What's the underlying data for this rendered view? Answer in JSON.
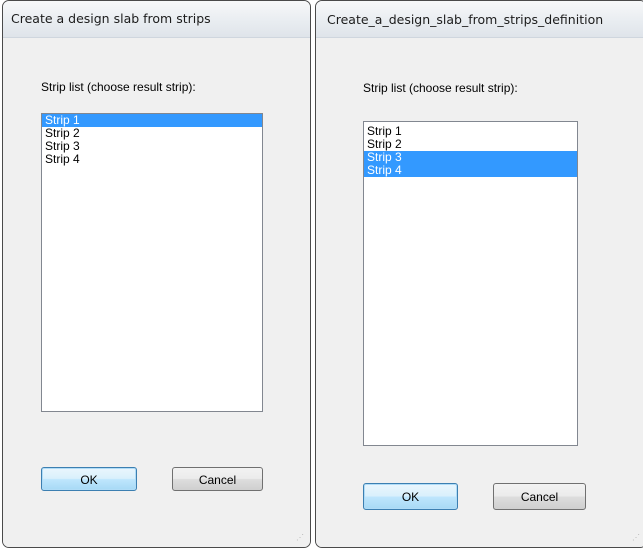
{
  "dialog1": {
    "title": "Create a design slab from strips",
    "label": "Strip list (choose result strip):",
    "items": [
      "Strip 1",
      "Strip 2",
      "Strip 3",
      "Strip 4"
    ],
    "selected": [
      0
    ],
    "ok_label": "OK",
    "cancel_label": "Cancel"
  },
  "dialog2": {
    "title": "Create_a_design_slab_from_strips_definition",
    "label": "Strip list (choose result strip):",
    "items": [
      "Strip 1",
      "Strip 2",
      "Strip 3",
      "Strip 4"
    ],
    "selected": [
      2,
      3
    ],
    "ok_label": "OK",
    "cancel_label": "Cancel"
  },
  "colors": {
    "selection": "#3399ff",
    "dialog_bg": "#f0f0f0",
    "default_button": "#bee6fd"
  }
}
